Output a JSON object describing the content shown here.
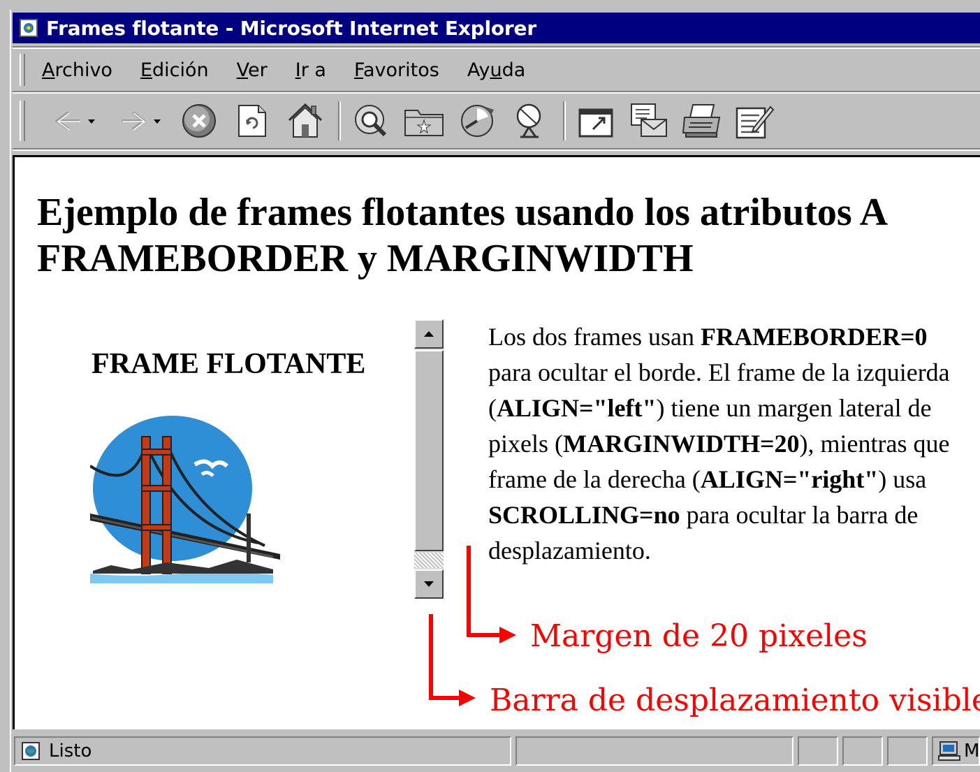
{
  "window": {
    "title": "Frames flotante - Microsoft Internet Explorer"
  },
  "menubar": {
    "items": [
      {
        "pre": "",
        "ul": "A",
        "post": "rchivo"
      },
      {
        "pre": "",
        "ul": "E",
        "post": "dición"
      },
      {
        "pre": "",
        "ul": "V",
        "post": "er"
      },
      {
        "pre": "",
        "ul": "I",
        "post": "r a"
      },
      {
        "pre": "",
        "ul": "F",
        "post": "avoritos"
      },
      {
        "pre": "Ay",
        "ul": "u",
        "post": "da"
      }
    ]
  },
  "toolbar": {
    "buttons": [
      "back-icon",
      "forward-icon",
      "stop-icon",
      "refresh-icon",
      "home-icon",
      "search-icon",
      "favorites-icon",
      "history-icon",
      "channels-icon",
      "fullscreen-icon",
      "mail-icon",
      "print-icon",
      "edit-icon"
    ]
  },
  "page": {
    "heading_line1": "Ejemplo de frames flotantes usando los atributos A",
    "heading_line2": "FRAMEBORDER y MARGINWIDTH",
    "left_frame_title": "FRAME FLOTANTE",
    "right_text": {
      "l1a": "Los dos frames usan ",
      "l1b": "FRAMEBORDER=0",
      "l2": "para ocultar el borde. El frame de la izquierda",
      "l3a": "(",
      "l3b": "ALIGN=\"left\"",
      "l3c": ") tiene un margen lateral de",
      "l4a": "pixels (",
      "l4b": "MARGINWIDTH=20",
      "l4c": "), mientras que",
      "l5a": "frame de la derecha (",
      "l5b": "ALIGN=\"right\"",
      "l5c": ") usa",
      "l6a": "SCROLLING=no",
      "l6b": " para ocultar la barra de",
      "l7": "desplazamiento."
    }
  },
  "annotations": {
    "margin_label": "Margen de 20 pixeles",
    "scrollbar_label": "Barra de desplazamiento visible",
    "color": "#ff0000"
  },
  "statusbar": {
    "text": "Listo",
    "zone_text": "M"
  },
  "colors": {
    "titlebar": "#000080",
    "chrome": "#c0c0c0"
  }
}
